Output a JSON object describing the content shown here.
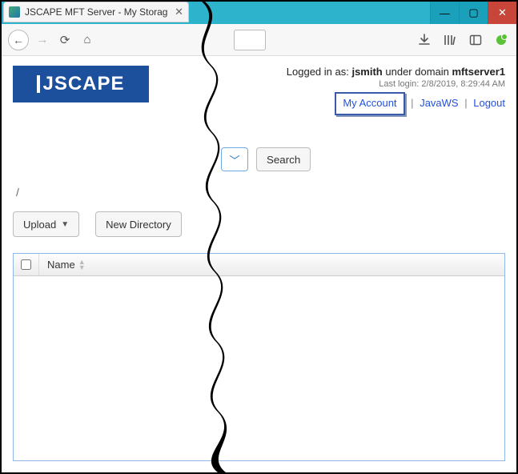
{
  "window": {
    "tab_title": "JSCAPE MFT Server - My Storag"
  },
  "logo_text": "JSCAPE",
  "login": {
    "prefix": "Logged in as: ",
    "user": "jsmith",
    "mid": " under domain ",
    "domain": "mftserver1",
    "lastlogin_label": "Last login: ",
    "lastlogin_value": "2/8/2019, 8:29:44 AM",
    "my_account": "My Account",
    "javaws": "JavaWS",
    "logout": "Logout"
  },
  "search": {
    "button": "Search"
  },
  "breadcrumb": "/",
  "actions": {
    "upload": "Upload",
    "newdir": "New Directory"
  },
  "table": {
    "col_name": "Name"
  }
}
